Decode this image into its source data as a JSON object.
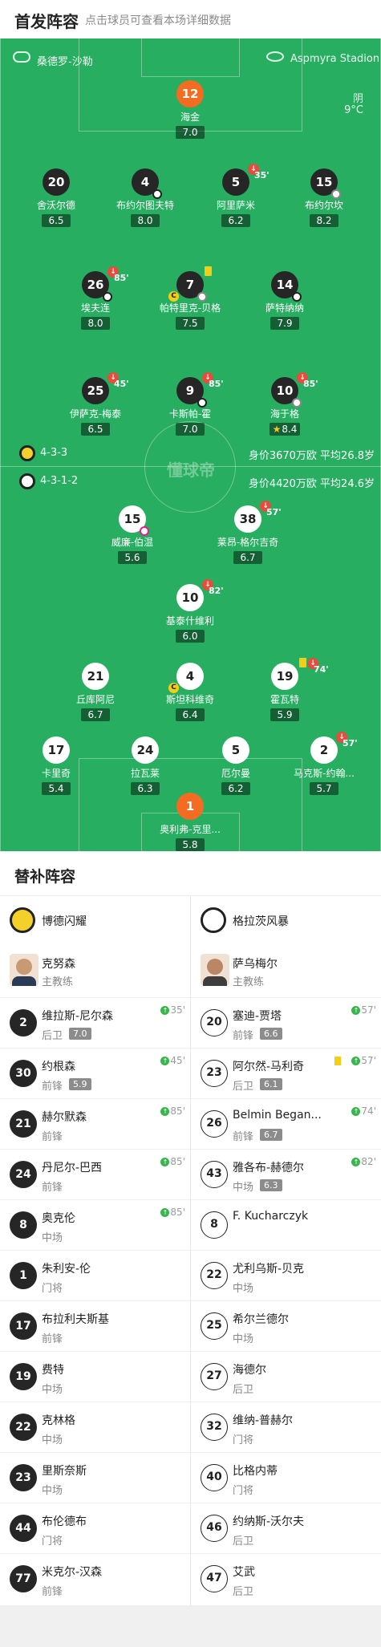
{
  "header": {
    "title": "首发阵容",
    "subtitle": "点击球员可查看本场详细数据"
  },
  "pitch_top": {
    "coach_label": "桑德罗-沙勒",
    "stadium": "Aspmyra Stadion",
    "weather": "阴",
    "temperature": "9°C"
  },
  "watermark": "懂球帝",
  "home_team_info": {
    "formation": "4-3-3",
    "value_age": "身价3670万欧 平均26.8岁"
  },
  "away_team_info": {
    "formation": "4-3-1-2",
    "value_age": "身价4420万欧 平均24.6岁"
  },
  "home_players": [
    {
      "num": "12",
      "name": "海金",
      "rating": "7.0"
    },
    {
      "num": "20",
      "name": "舍沃尔德",
      "rating": "6.5"
    },
    {
      "num": "4",
      "name": "布约尔图夫特",
      "rating": "8.0"
    },
    {
      "num": "5",
      "name": "阿里萨米",
      "rating": "6.2",
      "sub": "35'"
    },
    {
      "num": "15",
      "name": "布约尔坎",
      "rating": "8.2"
    },
    {
      "num": "26",
      "name": "埃夫连",
      "rating": "8.0",
      "sub": "85'"
    },
    {
      "num": "7",
      "name": "帕特里克-贝格",
      "rating": "7.5"
    },
    {
      "num": "14",
      "name": "萨特纳纳",
      "rating": "7.9"
    },
    {
      "num": "25",
      "name": "伊萨克-梅泰",
      "rating": "6.5",
      "sub": "45'"
    },
    {
      "num": "9",
      "name": "卡斯帕-霍",
      "rating": "7.0",
      "sub": "85'"
    },
    {
      "num": "10",
      "name": "海于格",
      "rating": "8.4",
      "sub": "85'"
    }
  ],
  "away_players": [
    {
      "num": "15",
      "name": "威廉-伯温",
      "rating": "5.6"
    },
    {
      "num": "38",
      "name": "莱昂-格尔吉奇",
      "rating": "6.7",
      "sub": "57'"
    },
    {
      "num": "10",
      "name": "基泰什维利",
      "rating": "6.0",
      "sub": "82'"
    },
    {
      "num": "21",
      "name": "丘库阿尼",
      "rating": "6.7"
    },
    {
      "num": "4",
      "name": "斯坦科维奇",
      "rating": "6.4"
    },
    {
      "num": "19",
      "name": "霍瓦特",
      "rating": "5.9",
      "sub": "74'"
    },
    {
      "num": "17",
      "name": "卡里奇",
      "rating": "5.4"
    },
    {
      "num": "24",
      "name": "拉瓦莱",
      "rating": "6.3"
    },
    {
      "num": "5",
      "name": "厄尔曼",
      "rating": "6.2"
    },
    {
      "num": "2",
      "name": "马克斯-约翰...",
      "rating": "5.7",
      "sub": "57'"
    },
    {
      "num": "1",
      "name": "奥利弗-克里...",
      "rating": "5.8"
    }
  ],
  "subs": {
    "title": "替补阵容",
    "home": {
      "team": "博德闪耀",
      "coach": {
        "name": "克努森",
        "role": "主教练"
      },
      "list": [
        {
          "num": "2",
          "name": "维拉斯-尼尔森",
          "pos": "后卫",
          "rating": "7.0",
          "min": "35'"
        },
        {
          "num": "30",
          "name": "约根森",
          "pos": "前锋",
          "rating": "5.9",
          "min": "45'"
        },
        {
          "num": "21",
          "name": "赫尔默森",
          "pos": "前锋",
          "min": "85'"
        },
        {
          "num": "24",
          "name": "丹尼尔-巴西",
          "pos": "前锋",
          "min": "85'"
        },
        {
          "num": "8",
          "name": "奥克伦",
          "pos": "中场",
          "min": "85'"
        },
        {
          "num": "1",
          "name": "朱利安-伦",
          "pos": "门将"
        },
        {
          "num": "17",
          "name": "布拉利夫斯基",
          "pos": "前锋"
        },
        {
          "num": "19",
          "name": "费特",
          "pos": "中场"
        },
        {
          "num": "22",
          "name": "克林格",
          "pos": "中场"
        },
        {
          "num": "23",
          "name": "里斯奈斯",
          "pos": "中场"
        },
        {
          "num": "44",
          "name": "布伦德布",
          "pos": "门将"
        },
        {
          "num": "77",
          "name": "米克尔-汉森",
          "pos": "前锋"
        }
      ]
    },
    "away": {
      "team": "格拉茨风暴",
      "coach": {
        "name": "萨乌梅尔",
        "role": "主教练"
      },
      "list": [
        {
          "num": "20",
          "name": "塞迪-贾塔",
          "pos": "前锋",
          "rating": "6.6",
          "min": "57'"
        },
        {
          "num": "23",
          "name": "阿尔然-马利奇",
          "pos": "后卫",
          "rating": "6.1",
          "min": "57'"
        },
        {
          "num": "26",
          "name": "Belmin Began...",
          "pos": "前锋",
          "rating": "6.7",
          "min": "74'"
        },
        {
          "num": "43",
          "name": "雅各布-赫德尔",
          "pos": "中场",
          "rating": "6.3",
          "min": "82'"
        },
        {
          "num": "8",
          "name": "F. Kucharczyk",
          "pos": ""
        },
        {
          "num": "22",
          "name": "尤利乌斯-贝克",
          "pos": "中场"
        },
        {
          "num": "25",
          "name": "希尔兰德尔",
          "pos": "中场"
        },
        {
          "num": "27",
          "name": "海德尔",
          "pos": "后卫"
        },
        {
          "num": "32",
          "name": "维纳-普赫尔",
          "pos": "门将"
        },
        {
          "num": "40",
          "name": "比格内蒂",
          "pos": "门将"
        },
        {
          "num": "46",
          "name": "约纳斯-沃尔夫",
          "pos": "后卫"
        },
        {
          "num": "47",
          "name": "艾武",
          "pos": "后卫"
        }
      ]
    }
  },
  "colors": {
    "pitch": "#27ae60",
    "keeper": "#f36c21",
    "sub_out": "#e74c3c",
    "sub_in": "#3ab44f",
    "yellow_card": "#f2cf16"
  }
}
